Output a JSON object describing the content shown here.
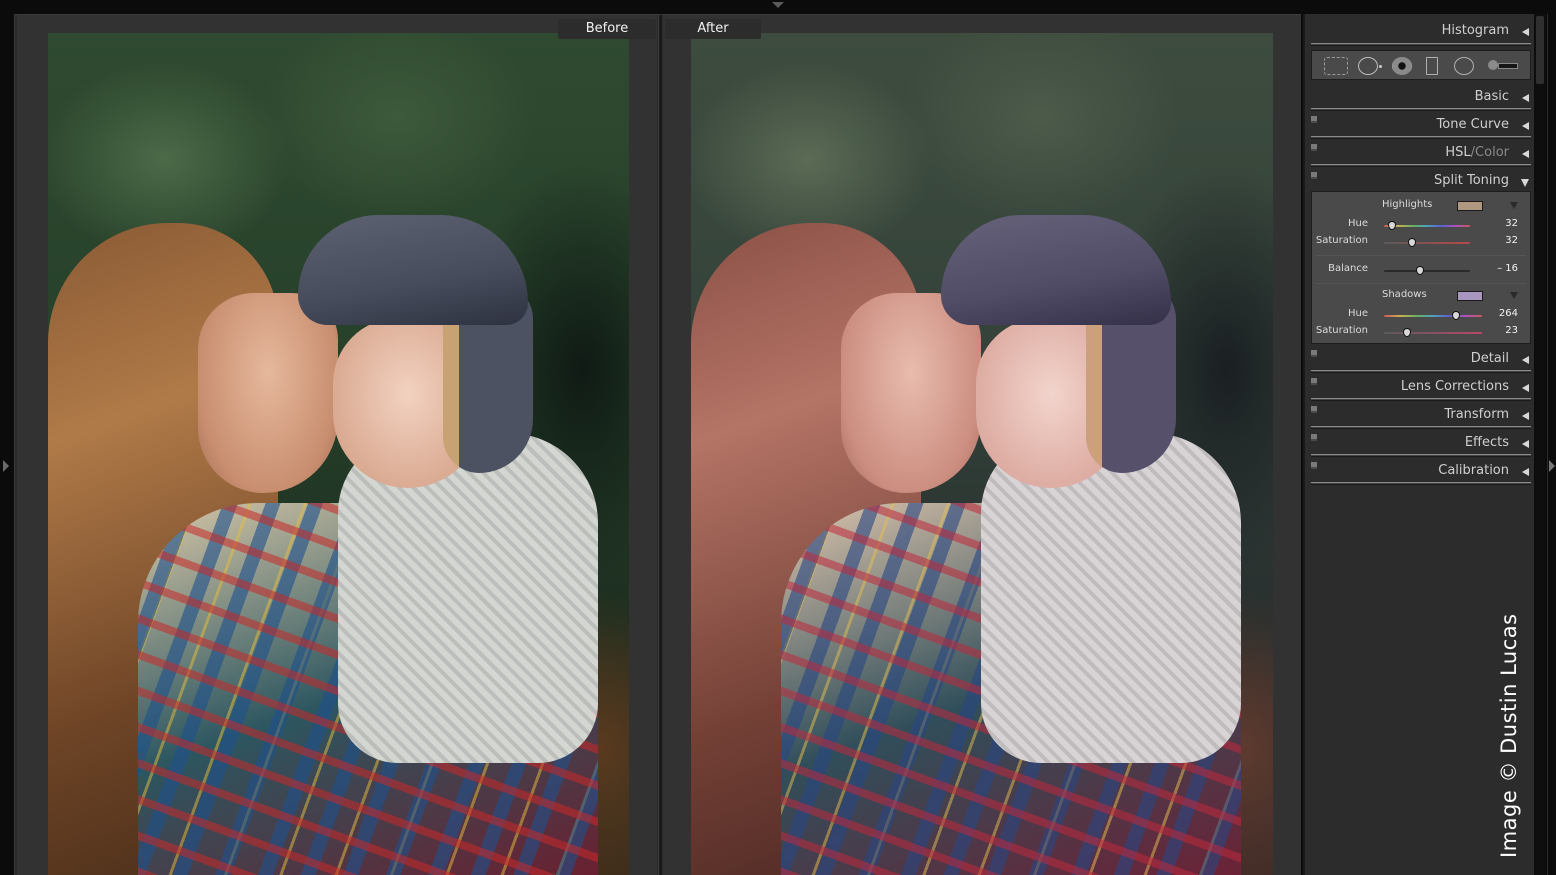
{
  "compare_view": {
    "before_label": "Before",
    "after_label": "After",
    "before_photo": {
      "description": "Original photo: mother kissing toddler in grey cap, plaid blanket, green trees background"
    },
    "after_photo": {
      "description": "Split-toned edit of same photo with warm highlights and purple shadows"
    }
  },
  "develop_panel": {
    "histogram": {
      "title": "Histogram",
      "icon": "triangle-left-icon"
    },
    "tool_strip": {
      "tools": [
        {
          "name": "crop-overlay-tool",
          "icon": "crop-grid-icon"
        },
        {
          "name": "spot-removal-tool",
          "icon": "spot-circle-icon"
        },
        {
          "name": "red-eye-tool",
          "icon": "red-eye-icon"
        },
        {
          "name": "graduated-filter-tool",
          "icon": "rectangle-icon"
        },
        {
          "name": "radial-filter-tool",
          "icon": "circle-icon"
        },
        {
          "name": "adjustment-brush-tool",
          "icon": "brush-slider-icon"
        }
      ]
    },
    "sections": [
      {
        "title": "Basic",
        "expanded": false,
        "has_toggle": false
      },
      {
        "title": "Tone Curve",
        "expanded": false,
        "has_toggle": true
      },
      {
        "title_main": "HSL",
        "title_sep": "/",
        "title_alt": "Color",
        "expanded": false,
        "has_toggle": true
      },
      {
        "title": "Split Toning",
        "expanded": true,
        "has_toggle": true
      },
      {
        "title": "Detail",
        "expanded": false,
        "has_toggle": true
      },
      {
        "title": "Lens Corrections",
        "expanded": false,
        "has_toggle": true
      },
      {
        "title": "Transform",
        "expanded": false,
        "has_toggle": true
      },
      {
        "title": "Effects",
        "expanded": false,
        "has_toggle": true
      },
      {
        "title": "Calibration",
        "expanded": false,
        "has_toggle": true
      }
    ],
    "split_toning": {
      "highlights": {
        "label": "Highlights",
        "swatch_color": "#b09880",
        "hue": {
          "label": "Hue",
          "value": "32",
          "fraction": 0.09
        },
        "saturation": {
          "label": "Saturation",
          "value": "32",
          "fraction": 0.32
        }
      },
      "balance": {
        "label": "Balance",
        "value": "– 16",
        "fraction": 0.42
      },
      "shadows": {
        "label": "Shadows",
        "swatch_color": "#a898c0",
        "hue": {
          "label": "Hue",
          "value": "264",
          "fraction": 0.733
        },
        "saturation": {
          "label": "Saturation",
          "value": "23",
          "fraction": 0.23
        }
      }
    }
  },
  "watermark": "Image © Dustin Lucas"
}
